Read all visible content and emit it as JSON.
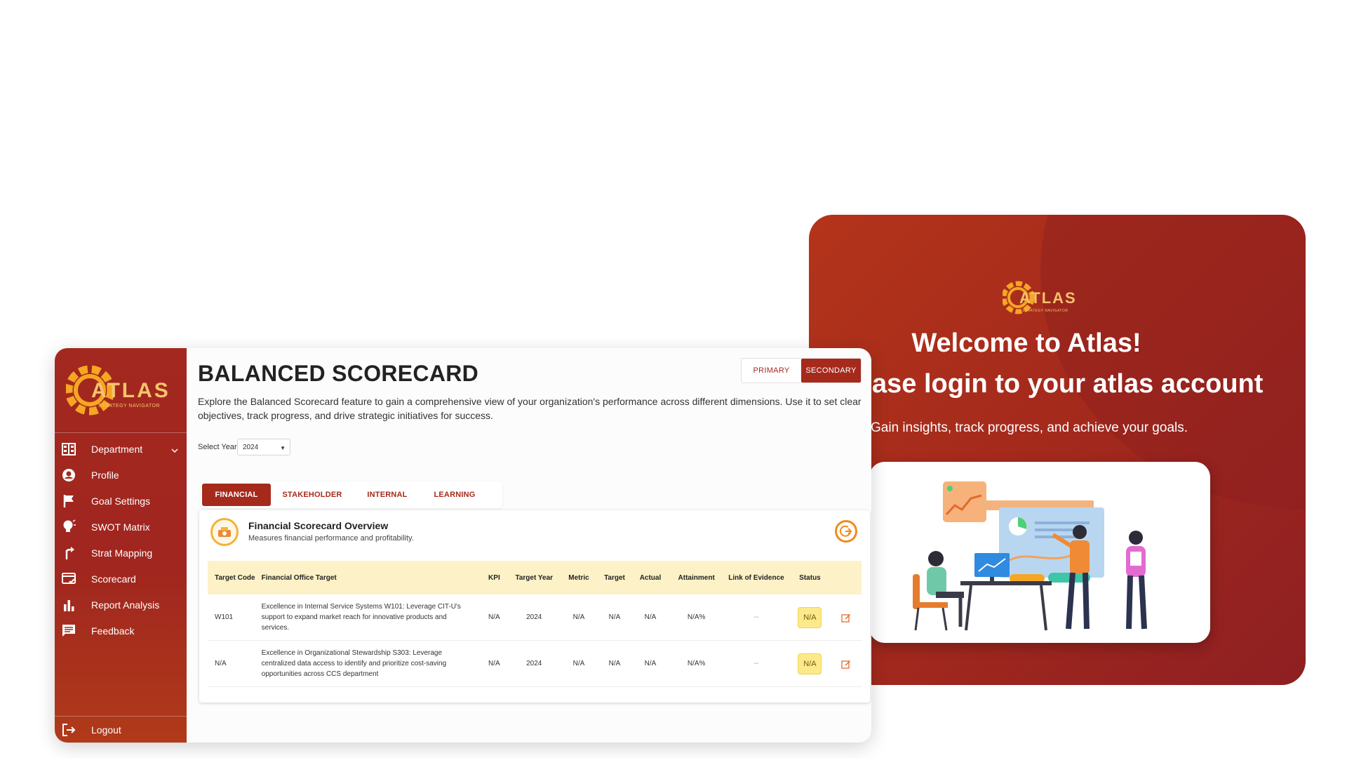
{
  "login": {
    "logo_text": "ATLAS",
    "logo_sub": "STRATEGY NAVIGATOR",
    "welcome": "Welcome to Atlas!",
    "prompt": "ase login to your atlas account",
    "tagline": "Gain insights, track progress, and achieve your goals."
  },
  "sidebar": {
    "logo_text": "ATLAS",
    "logo_sub": "STRATEGY NAVIGATOR",
    "items": [
      {
        "label": "Department",
        "icon": "building-icon"
      },
      {
        "label": "Profile",
        "icon": "account-circle-icon"
      },
      {
        "label": "Goal Settings",
        "icon": "flag-icon"
      },
      {
        "label": "SWOT Matrix",
        "icon": "lightbulb-icon"
      },
      {
        "label": "Strat Mapping",
        "icon": "route-icon"
      },
      {
        "label": "Scorecard",
        "icon": "scorecard-icon"
      },
      {
        "label": "Report Analysis",
        "icon": "bar-chart-icon"
      },
      {
        "label": "Feedback",
        "icon": "feedback-icon"
      }
    ],
    "logout": "Logout"
  },
  "header": {
    "title": "BALANCED SCORECARD",
    "toggle": {
      "primary": "PRIMARY",
      "secondary": "SECONDARY",
      "active": "SECONDARY"
    },
    "description": "Explore the Balanced Scorecard feature to gain a comprehensive view of your organization's performance across different dimensions. Use it to set clear objectives, track progress, and drive strategic initiatives for success."
  },
  "year": {
    "label": "Select Year:",
    "value": "2024"
  },
  "tabs": [
    "FINANCIAL",
    "STAKEHOLDER",
    "INTERNAL",
    "LEARNING"
  ],
  "card": {
    "title": "Financial Scorecard Overview",
    "subtitle": "Measures financial performance and profitability."
  },
  "table": {
    "headers": {
      "code": "Target Code",
      "target_desc": "Financial Office Target",
      "kpi": "KPI",
      "year": "Target Year",
      "metric": "Metric",
      "target": "Target",
      "actual": "Actual",
      "attainment": "Attainment",
      "link": "Link of Evidence",
      "status": "Status"
    },
    "rows": [
      {
        "code": "W101",
        "target_desc": "Excellence in Internal Service Systems W101: Leverage CIT-U's support to expand market reach for innovative products and services.",
        "kpi": "N/A",
        "year": "2024",
        "metric": "N/A",
        "target": "N/A",
        "actual": "N/A",
        "attainment": "N/A%",
        "link": "--",
        "status": "N/A"
      },
      {
        "code": "N/A",
        "target_desc": "Excellence in Organizational Stewardship S303: Leverage centralized data access to identify and prioritize cost-saving opportunities across CCS department",
        "kpi": "N/A",
        "year": "2024",
        "metric": "N/A",
        "target": "N/A",
        "actual": "N/A",
        "attainment": "N/A%",
        "link": "--",
        "status": "N/A"
      }
    ]
  },
  "colors": {
    "brand": "#a52a1c",
    "accent": "#f4b23a",
    "badge": "#fde98a"
  }
}
